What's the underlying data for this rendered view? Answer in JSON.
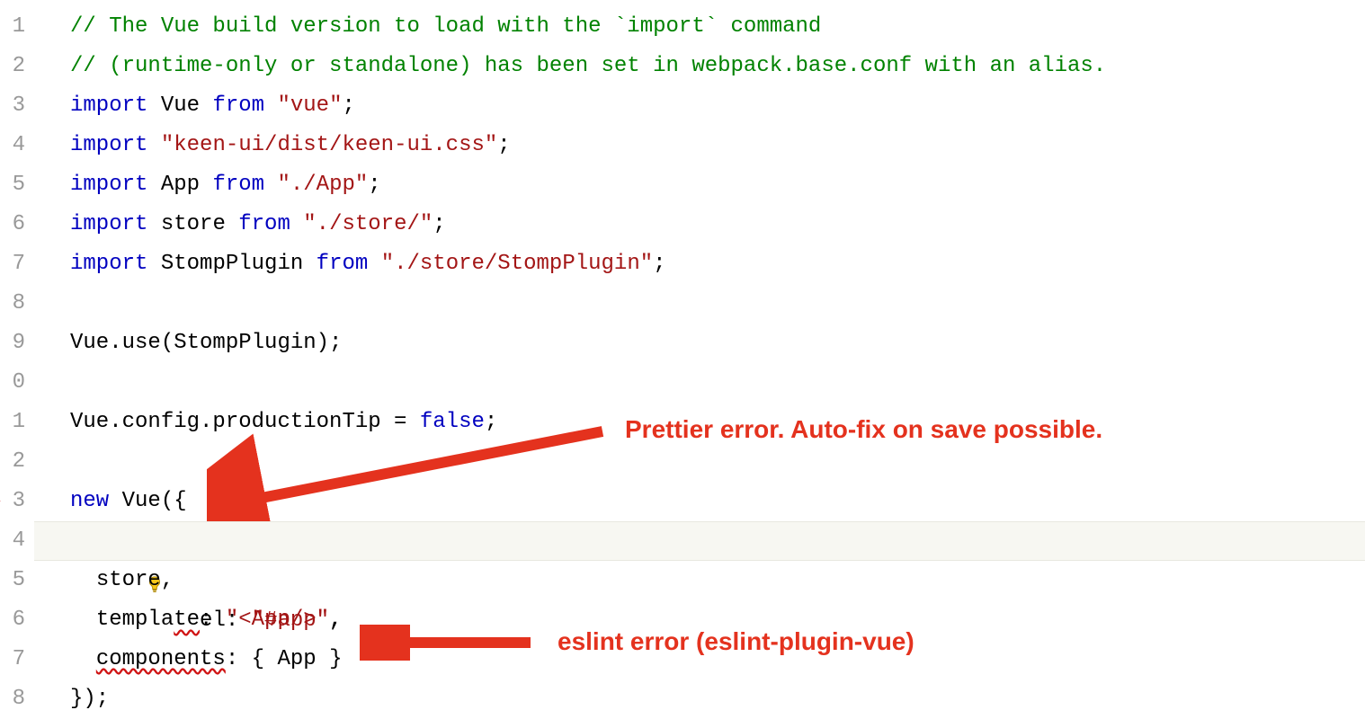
{
  "gutter": {
    "numbers": [
      "1",
      "2",
      "3",
      "4",
      "5",
      "6",
      "7",
      "8",
      "9",
      "0",
      "1",
      "2",
      "3",
      "4",
      "5",
      "6",
      "7",
      "8"
    ]
  },
  "code": {
    "lines": [
      {
        "kind": "comment",
        "text": "// The Vue build version to load with the `import` command"
      },
      {
        "kind": "comment",
        "text": "// (runtime-only or standalone) has been set in webpack.base.conf with an alias."
      },
      {
        "kind": "import",
        "kw1": "import",
        "ident": "Vue",
        "kw2": "from",
        "str": "\"vue\"",
        "tail": ";"
      },
      {
        "kind": "import-side",
        "kw1": "import",
        "str": "\"keen-ui/dist/keen-ui.css\"",
        "tail": ";"
      },
      {
        "kind": "import",
        "kw1": "import",
        "ident": "App",
        "kw2": "from",
        "str": "\"./App\"",
        "tail": ";"
      },
      {
        "kind": "import",
        "kw1": "import",
        "ident": "store",
        "kw2": "from",
        "str": "\"./store/\"",
        "tail": ";"
      },
      {
        "kind": "import",
        "kw1": "import",
        "ident": "StompPlugin",
        "kw2": "from",
        "str": "\"./store/StompPlugin\"",
        "tail": ";"
      },
      {
        "kind": "blank"
      },
      {
        "kind": "stmt",
        "text": "Vue.use(StompPlugin);"
      },
      {
        "kind": "blank"
      },
      {
        "kind": "assign",
        "lhs": "Vue.config.productionTip = ",
        "rhs_kw": "false",
        "tail": ";"
      },
      {
        "kind": "blank"
      },
      {
        "kind": "new",
        "kw": "new",
        "ident": " Vue({"
      },
      {
        "kind": "prop-el",
        "indent": "  ",
        "squiggle_pre": "  ",
        "key": "el: ",
        "str": "\"#app\"",
        "tail": ",",
        "highlight": true,
        "bulb": true
      },
      {
        "kind": "stmt-indent",
        "indent": "  ",
        "text": "store,"
      },
      {
        "kind": "prop-str",
        "indent": "  ",
        "key": "template: ",
        "str": "\"<App/>\"",
        "tail": ","
      },
      {
        "kind": "prop-comp",
        "indent": "  ",
        "squiggle_key": "components",
        "mid": ": { App }"
      },
      {
        "kind": "stmt",
        "text": "});"
      }
    ]
  },
  "annotations": {
    "label1": "Prettier error. Auto-fix on save possible.",
    "label2": "eslint error (eslint-plugin-vue)"
  }
}
